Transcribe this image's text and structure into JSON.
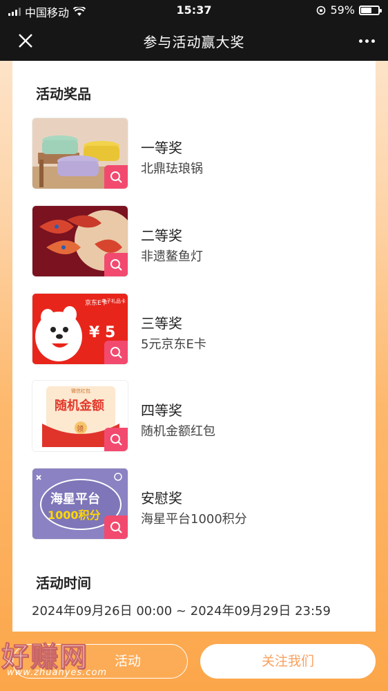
{
  "status_bar": {
    "carrier": "中国移动",
    "time": "15:37",
    "battery": "59%",
    "battery_level": 0.59
  },
  "nav": {
    "title": "参与活动赢大奖",
    "close_icon": "close-icon",
    "more_icon": "more-icon"
  },
  "prizes_section": {
    "title": "活动奖品",
    "items": [
      {
        "name": "一等奖",
        "desc": "北鼎珐琅锅",
        "image": "enamel-pot-image"
      },
      {
        "name": "二等奖",
        "desc": "非遗鳌鱼灯",
        "image": "fish-lantern-image"
      },
      {
        "name": "三等奖",
        "desc": "5元京东E卡",
        "image": "jd-e-card-image",
        "card_brand": "京东E卡",
        "card_sub": "电子礼品卡",
        "card_value": "¥ 5"
      },
      {
        "name": "四等奖",
        "desc": "随机金额红包",
        "image": "red-packet-image",
        "packet_title": "随机金额",
        "packet_small": "微信红包",
        "packet_btn": "领"
      },
      {
        "name": "安慰奖",
        "desc": "海星平台1000积分",
        "image": "points-image",
        "points_line1": "海星平台",
        "points_line2": "1000积分"
      }
    ]
  },
  "time_section": {
    "title": "活动时间",
    "range": "2024年09月26日 00:00 ~ 2024年09月29日 23:59"
  },
  "bottom": {
    "left_button": "活动",
    "right_button": "关注我们"
  },
  "watermark": {
    "cn": "好赚网",
    "en": "www.zhuanyes.com"
  },
  "colors": {
    "accent": "#f24a6f",
    "follow_text": "#f9a05e",
    "bg_orange": "#fca64a"
  }
}
